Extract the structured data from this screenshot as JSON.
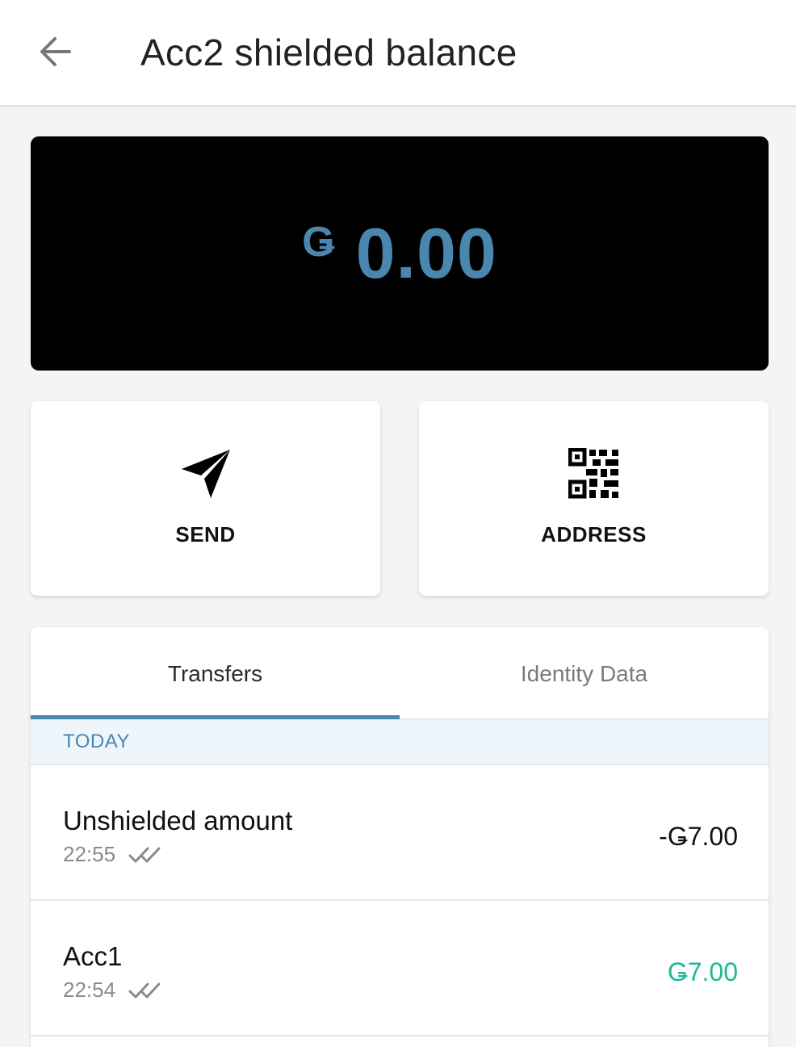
{
  "appbar": {
    "title": "Acc2 shielded balance",
    "back_icon": "arrow-left-icon"
  },
  "balance": {
    "currency_symbol": "Ǥ",
    "amount": "0.00",
    "color": "#4a86ad"
  },
  "actions": {
    "send_label": "SEND",
    "send_icon": "paper-plane-icon",
    "address_label": "ADDRESS",
    "address_icon": "qr-code-icon"
  },
  "tabs": [
    {
      "label": "Transfers",
      "active": true
    },
    {
      "label": "Identity Data",
      "active": false
    }
  ],
  "section": {
    "header": "TODAY"
  },
  "transfers": [
    {
      "name": "Unshielded amount",
      "time": "22:55",
      "amount": "-Ǥ7.00",
      "direction": "out",
      "status_icon": "double-check-icon"
    },
    {
      "name": "Acc1",
      "time": "22:54",
      "amount": "Ǥ7.00",
      "direction": "in",
      "status_icon": "double-check-icon"
    }
  ],
  "colors": {
    "accent": "#4a86ad",
    "positive": "#1fb894",
    "section_bg": "#eef6fb"
  }
}
